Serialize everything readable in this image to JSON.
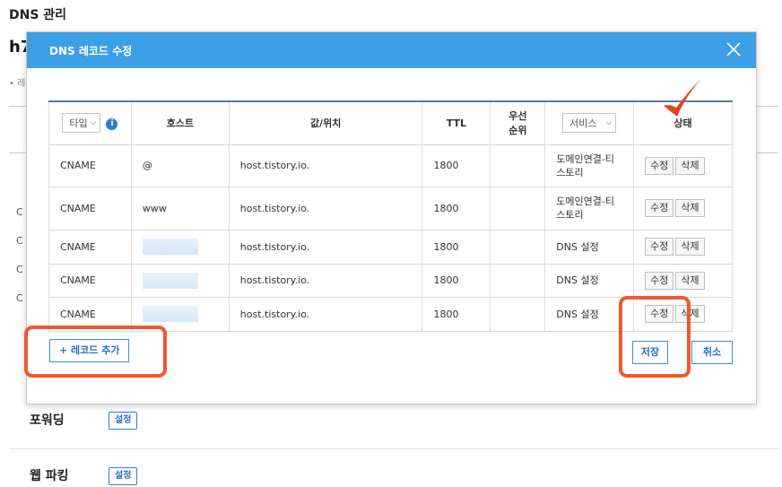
{
  "background": {
    "title": "DNS 관리",
    "heading_fragment": "h7",
    "bullet_fragment": "• 레",
    "row_fragments": [
      "C",
      "C",
      "C",
      "C"
    ],
    "forwarding_label": "포워딩",
    "forwarding_button": "설정",
    "webparking_label": "웹 파킹",
    "webparking_button": "설정"
  },
  "modal": {
    "title": "DNS 레코드 수정",
    "close_icon": "close-icon",
    "header_color": "#3d9fe6"
  },
  "table": {
    "type_select": "타입",
    "columns": {
      "host": "호스트",
      "value": "값/위치",
      "ttl": "TTL",
      "priority_line1": "우선",
      "priority_line2": "순위",
      "service_select": "서비스",
      "status": "상태"
    },
    "rows": [
      {
        "type": "CNAME",
        "host": "@",
        "value": "host.tistory.io.",
        "ttl": "1800",
        "priority": "",
        "service_line1": "도메인연결-티",
        "service_line2": "스토리",
        "edit": "수정",
        "delete": "삭제"
      },
      {
        "type": "CNAME",
        "host": "www",
        "value": "host.tistory.io.",
        "ttl": "1800",
        "priority": "",
        "service_line1": "도메인연결-티",
        "service_line2": "스토리",
        "edit": "수정",
        "delete": "삭제"
      },
      {
        "type": "CNAME",
        "host": "",
        "value": "host.tistory.io.",
        "ttl": "1800",
        "priority": "",
        "service_line1": "DNS 설정",
        "service_line2": "",
        "edit": "수정",
        "delete": "삭제"
      },
      {
        "type": "CNAME",
        "host": "",
        "value": "host.tistory.io.",
        "ttl": "1800",
        "priority": "",
        "service_line1": "DNS 설정",
        "service_line2": "",
        "edit": "수정",
        "delete": "삭제"
      },
      {
        "type": "CNAME",
        "host": "",
        "value": "host.tistory.io.",
        "ttl": "1800",
        "priority": "",
        "service_line1": "DNS 설정",
        "service_line2": "",
        "edit": "수정",
        "delete": "삭제"
      }
    ]
  },
  "actions": {
    "add_record": "+ 레코드 추가",
    "save": "저장",
    "cancel": "취소"
  },
  "colors": {
    "accent": "#3d9fe6",
    "annotation": "#f2562e",
    "checkmark": "#e0461c"
  }
}
